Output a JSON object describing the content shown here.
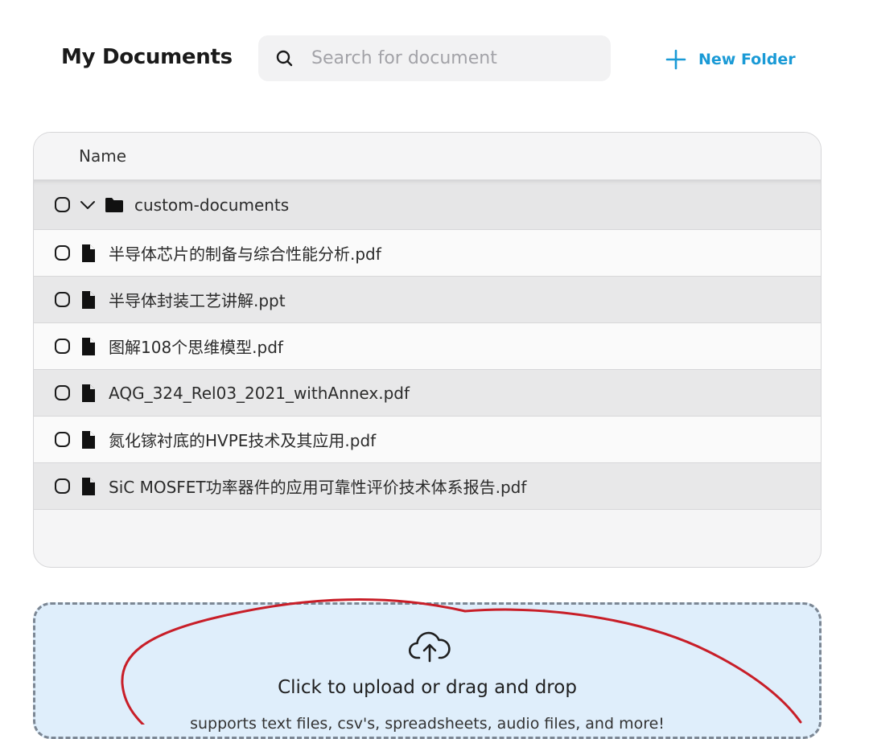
{
  "header": {
    "title": "My Documents",
    "search_placeholder": "Search for document",
    "search_value": "",
    "new_folder_label": "New Folder"
  },
  "table": {
    "column_name": "Name",
    "folder": {
      "name": "custom-documents",
      "expanded": true
    },
    "files": [
      {
        "name": "半导体芯片的制备与综合性能分析.pdf"
      },
      {
        "name": "半导体封装工艺讲解.ppt"
      },
      {
        "name": "图解108个思维模型.pdf"
      },
      {
        "name": "AQG_324_Rel03_2021_withAnnex.pdf"
      },
      {
        "name": "氮化镓衬底的HVPE技术及其应用.pdf"
      },
      {
        "name": "SiC MOSFET功率器件的应用可靠性评价技术体系报告.pdf"
      }
    ]
  },
  "upload": {
    "title": "Click to upload or drag and drop",
    "subtitle": "supports text files, csv's, spreadsheets, audio files, and more!"
  },
  "colors": {
    "accent": "#1a9ad6",
    "upload_bg": "#dfeefb",
    "annotation_stroke": "#c81e28"
  }
}
